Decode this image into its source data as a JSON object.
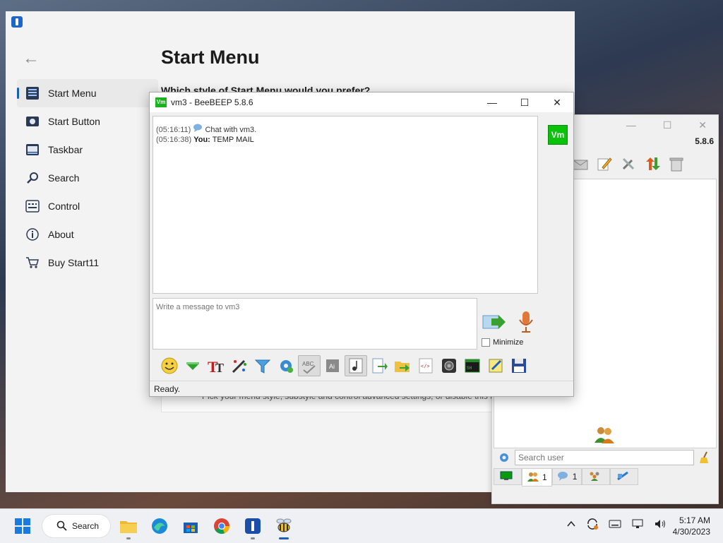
{
  "start11": {
    "page_title": "Start Menu",
    "question": "Which style of Start Menu would you prefer?",
    "nav": [
      {
        "label": "Start Menu",
        "icon": "start-menu-icon"
      },
      {
        "label": "Start Button",
        "icon": "start-button-icon"
      },
      {
        "label": "Taskbar",
        "icon": "taskbar-icon"
      },
      {
        "label": "Search",
        "icon": "search-icon"
      },
      {
        "label": "Control",
        "icon": "keyboard-icon"
      },
      {
        "label": "About",
        "icon": "info-icon"
      },
      {
        "label": "Buy Start11",
        "icon": "cart-icon"
      }
    ],
    "card_description": "Pick your menu style, substyle and control advanced settings, or disable this to"
  },
  "chat": {
    "title": "vm3 - BeeBEEP 5.8.6",
    "app_badge": "Vm",
    "avatar_text": "Vm",
    "messages": [
      {
        "time": "(05:16:11)",
        "sender": "",
        "text": "Chat with vm3."
      },
      {
        "time": "(05:16:38)",
        "sender": "You:",
        "text": "TEMP MAIL"
      }
    ],
    "input_placeholder": "Write a message to vm3",
    "minimize_label": "Minimize",
    "status": "Ready."
  },
  "buddy": {
    "version": "5.8.6",
    "search_placeholder": "Search user",
    "tabs": [
      {
        "icon": "computer-icon",
        "count": ""
      },
      {
        "icon": "users-icon",
        "count": "1"
      },
      {
        "icon": "chat-bubble-icon",
        "count": "1"
      },
      {
        "icon": "group-icon",
        "count": ""
      },
      {
        "icon": "share-icon",
        "count": ""
      }
    ]
  },
  "taskbar": {
    "search_label": "Search",
    "time": "5:17 AM",
    "date": "4/30/2023"
  },
  "colors": {
    "accent": "#1a5fb4",
    "beebeep_green": "#19b31e"
  }
}
